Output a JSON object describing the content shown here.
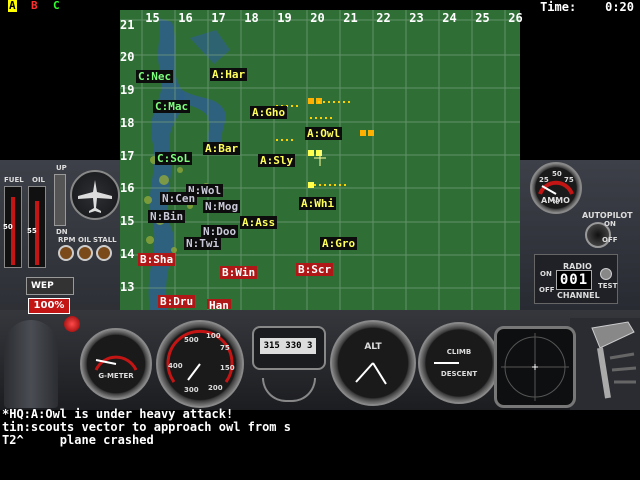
{
  "top_bar": {
    "team_tags": [
      {
        "label": "A",
        "color": "#ffff00"
      },
      {
        "label": "B",
        "color": "#ff3030"
      },
      {
        "label": "C",
        "color": "#30ff30"
      }
    ],
    "time_label": "Time:",
    "time_value": "0:20"
  },
  "map": {
    "columns": [
      "15",
      "16",
      "17",
      "18",
      "19",
      "20",
      "21",
      "22",
      "23",
      "24",
      "25",
      "26"
    ],
    "rows": [
      "21",
      "20",
      "19",
      "18",
      "17",
      "16",
      "15",
      "14",
      "13"
    ],
    "units": [
      {
        "label": "C:Nec",
        "team": "C"
      },
      {
        "label": "A:Har",
        "team": "A"
      },
      {
        "label": "C:Mac",
        "team": "C"
      },
      {
        "label": "A:Gho",
        "team": "A"
      },
      {
        "label": "A:Owl",
        "team": "A"
      },
      {
        "label": "A:Bar",
        "team": "A"
      },
      {
        "label": "C:SoL",
        "team": "C"
      },
      {
        "label": "A:Sly",
        "team": "A"
      },
      {
        "label": "N:Wol",
        "team": "N"
      },
      {
        "label": "N:Cen",
        "team": "N"
      },
      {
        "label": "A:Whi",
        "team": "A"
      },
      {
        "label": "N:Mog",
        "team": "N"
      },
      {
        "label": "N:Bin",
        "team": "N"
      },
      {
        "label": "A:Ass",
        "team": "A"
      },
      {
        "label": "N:Doo",
        "team": "N"
      },
      {
        "label": "N:Twi",
        "team": "N"
      },
      {
        "label": "A:Gro",
        "team": "A"
      },
      {
        "label": "B:Sha",
        "team": "B"
      },
      {
        "label": "B:Win",
        "team": "B"
      },
      {
        "label": "B:Scr",
        "team": "B"
      },
      {
        "label": "B:Dru",
        "team": "B"
      },
      {
        "label": "Han",
        "team": "B"
      }
    ]
  },
  "left_panel": {
    "fuel_label": "FUEL",
    "oil_label": "OIL",
    "up_label": "UP",
    "dn_label": "DN",
    "rpm_label": "RPM",
    "oil2_label": "OIL",
    "stall_label": "STALL",
    "wep_label": "WEP",
    "throttle_label": "100%",
    "scale_50": "50",
    "scale_55": "55"
  },
  "right_panel": {
    "ammo_label": "AMMO",
    "ammo_pct": "%",
    "ammo_ticks": [
      "25",
      "50",
      "75"
    ],
    "ammo_level": 0.35,
    "autopilot_label": "AUTOPILOT",
    "autopilot_on": "ON",
    "autopilot_off": "OFF",
    "radio_label": "RADIO",
    "radio_channel_label": "CHANNEL",
    "radio_channel": "001",
    "radio_on": "ON",
    "radio_off": "OFF",
    "radio_test": "TEST"
  },
  "instruments": {
    "gmeter_label": "G-METER",
    "speed_ticks": [
      "500",
      "100",
      "75",
      "400",
      "150",
      "300",
      "200"
    ],
    "compass_values": [
      "315",
      "330",
      "3"
    ],
    "alt_label": "ALT",
    "climb_label": "CLIMB",
    "descent_label": "DESCENT"
  },
  "messages": [
    "*HQ:A:Owl is under heavy attack!",
    "tin:scouts vector to approach owl from s",
    "T2^     plane crashed"
  ]
}
